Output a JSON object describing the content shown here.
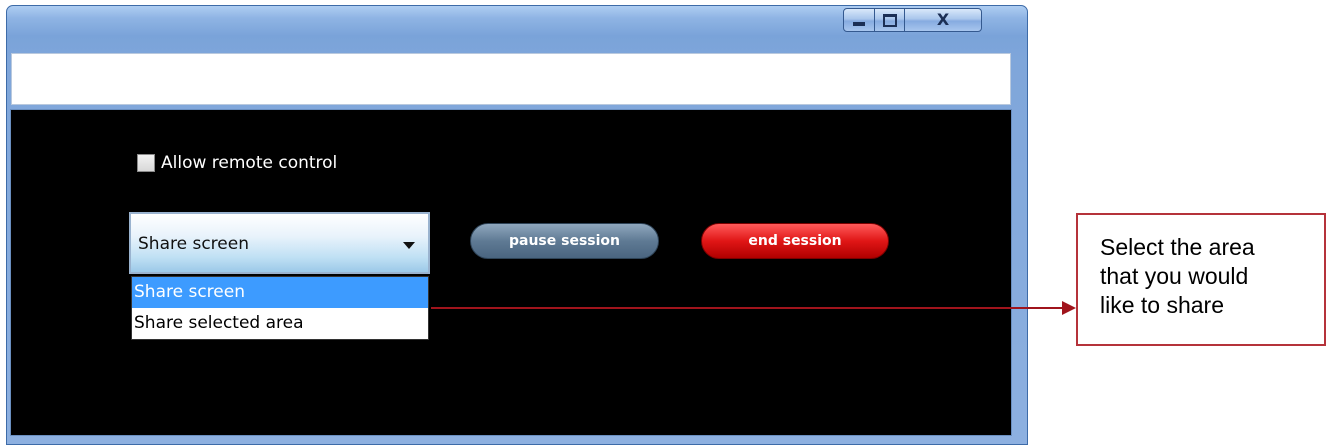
{
  "window": {
    "controls": {
      "minimize_icon": "minimize-icon",
      "maximize_icon": "maximize-icon",
      "close_glyph": "X"
    },
    "address_value": ""
  },
  "session": {
    "allow_remote_control_label": "Allow remote control",
    "allow_remote_control_checked": false,
    "share_select": {
      "selected": "Share screen",
      "options": [
        "Share screen",
        "Share selected area"
      ],
      "highlighted_index": 0
    },
    "pause_label": "pause session",
    "end_label": "end session"
  },
  "callout": {
    "line1": "Select the area",
    "line2": "that you would",
    "line3": "like to share"
  },
  "colors": {
    "client_bg": "#000000",
    "highlight": "#3d9bff",
    "pause_button": "#5f7a94",
    "end_button": "#e01616",
    "callout_border": "#b5323a"
  }
}
